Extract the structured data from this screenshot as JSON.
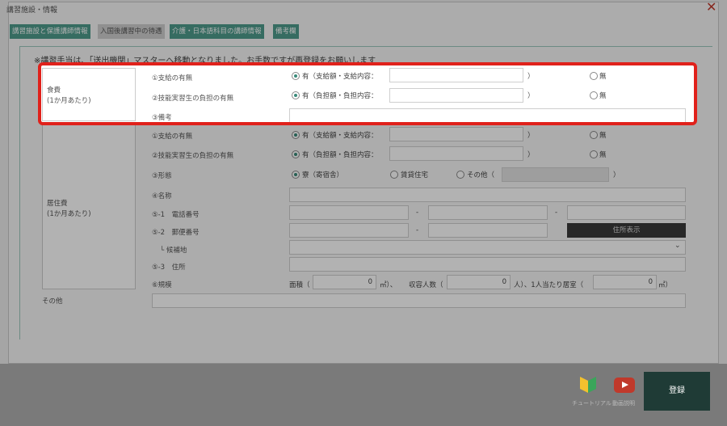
{
  "dialog": {
    "title": "講習施設・情報",
    "close": "✕",
    "tabs": [
      {
        "label": "講習施設と保護講師情報"
      },
      {
        "label": "入国後講習中の待遇"
      },
      {
        "label": "介護・日本語科目の講師情報"
      },
      {
        "label": "備考欄"
      }
    ],
    "notice": "※講習手当は、「送出機関」マスターへ移動となりました。お手数ですが再登録をお願いします"
  },
  "meals": {
    "label_line1": "食費",
    "label_line2": "(1か月あたり)",
    "rows": {
      "support": {
        "label": "①支給の有無",
        "yes": "有（支給額・支給内容：",
        "close": "）",
        "no": "無"
      },
      "burden": {
        "label": "②技能実習生の負担の有無",
        "yes": "有（負担額・負担内容：",
        "close": "）",
        "no": "無"
      },
      "note": {
        "label": "③備考"
      }
    }
  },
  "housing": {
    "label_line1": "居住費",
    "label_line2": "(1か月あたり)",
    "rows": {
      "support": {
        "label": "①支給の有無",
        "yes": "有（支給額・支給内容：",
        "close": "）",
        "no": "無"
      },
      "burden": {
        "label": "②技能実習生の負担の有無",
        "yes": "有（負担額・負担内容：",
        "close": "）",
        "no": "無"
      },
      "form": {
        "label": "③形態",
        "opt1": "寮（寄宿舎）",
        "opt2": "賃貸住宅",
        "opt3": "その他（",
        "close": "）"
      },
      "name": {
        "label": "④名称"
      },
      "phone": {
        "label": "⑤-1　電話番号",
        "dash": "-"
      },
      "postal": {
        "label": "⑤-2　郵便番号",
        "dash": "-",
        "button": "住所表示"
      },
      "candidate": {
        "label": "└ 候補地"
      },
      "address": {
        "label": "⑤-3　住所"
      },
      "scale": {
        "label": "⑥規模",
        "area_prefix": "面積（",
        "area_value": "0",
        "area_unit": "㎡）、",
        "cap_prefix": "収容人数（",
        "cap_value": "0",
        "cap_unit": "人）、1人当たり居室（",
        "room_value": "0",
        "room_unit": "㎡）"
      }
    }
  },
  "other": {
    "label": "その他"
  },
  "footer": {
    "tutorial": "チュートリアル",
    "video": "動画説明",
    "register": "登録"
  },
  "colors": {
    "accent": "#4e9b8c",
    "highlight": "#e0211b",
    "register": "#1f3b36"
  }
}
